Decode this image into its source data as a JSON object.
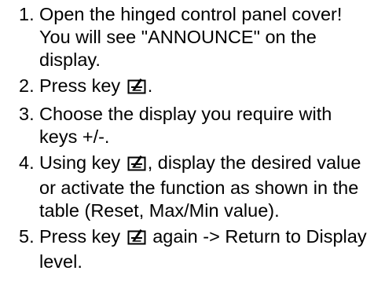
{
  "steps": [
    {
      "number": "1.",
      "text": "Open the hinged control panel cover! You will see \"ANNOUNCE\" on the display."
    },
    {
      "number": "2.",
      "before": "Press key ",
      "after": "."
    },
    {
      "number": "3.",
      "text": "Choose the display you require with keys +/-."
    },
    {
      "number": "4.",
      "before": "Using key ",
      "after": ", display the desired value or activate the function as shown in the table (Reset, Max/Min value)."
    },
    {
      "number": "5.",
      "before": "Press key ",
      "after": " again -> Return to Display level."
    }
  ],
  "icons": {
    "key": "enter-key-icon"
  }
}
